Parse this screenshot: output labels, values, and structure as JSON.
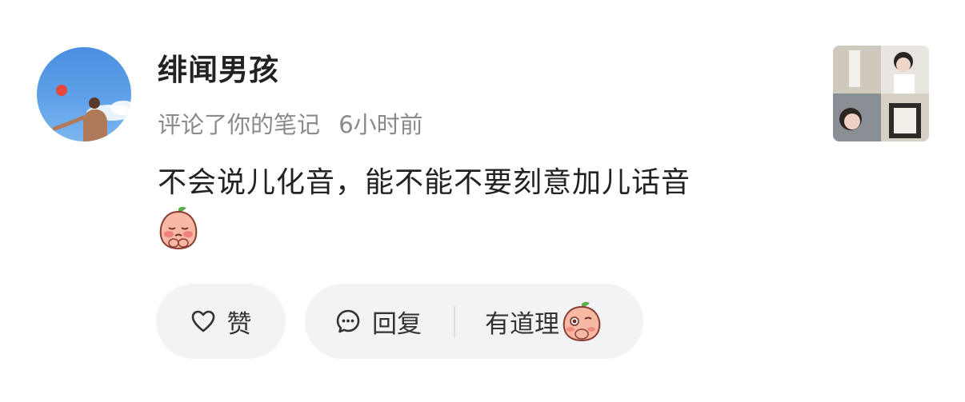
{
  "user": {
    "name": "绯闻男孩"
  },
  "activity": {
    "action": "评论了你的笔记",
    "time": "6小时前"
  },
  "comment": {
    "text": "不会说儿化音，能不能不要刻意加儿话音",
    "emoji": "peach-pleading-emoji"
  },
  "actions": {
    "like_label": "赞",
    "reply_label": "回复",
    "quick_reply_label": "有道理",
    "quick_reply_emoji": "peach-thinking-emoji"
  },
  "colors": {
    "pill_bg": "#f3f3f5",
    "meta_text": "#8a8a8a",
    "main_text": "#222222"
  }
}
